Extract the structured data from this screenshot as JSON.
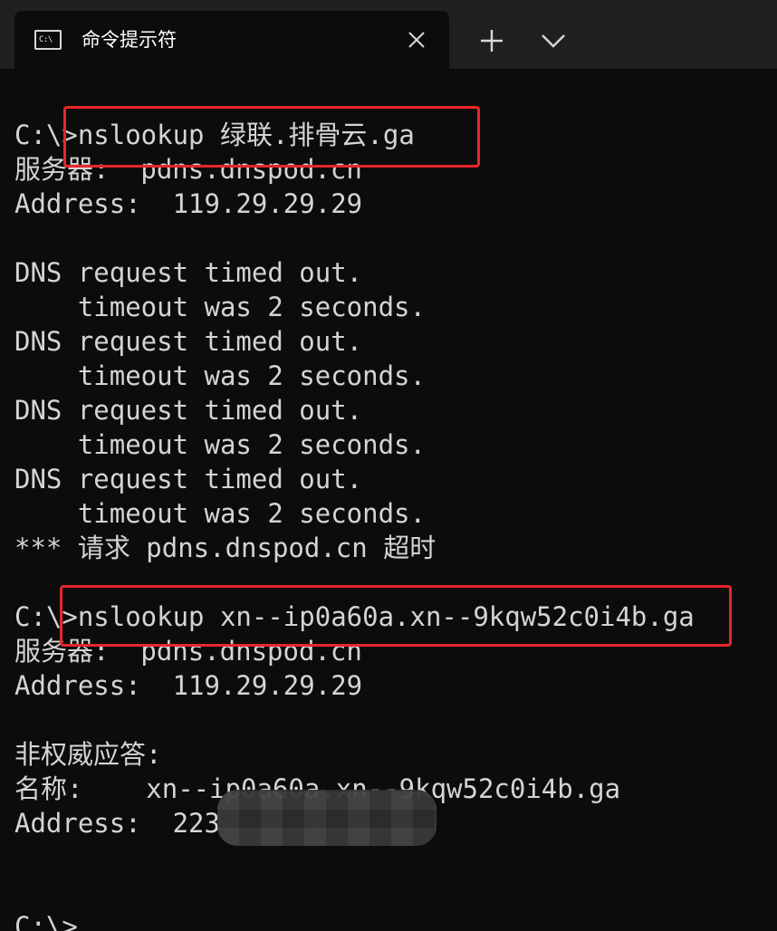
{
  "window": {
    "tab": {
      "title": "命令提示符",
      "icon_label": "C:\\",
      "icon": "cmd-icon",
      "close_icon": "close-icon"
    },
    "new_tab_icon": "plus-icon",
    "dropdown_icon": "chevron-down-icon"
  },
  "colors": {
    "background": "#0c0c0c",
    "tabbar": "#202020",
    "text": "#d4d4d4",
    "highlight": "#e8262c"
  },
  "terminal": {
    "lines": [
      "C:\\>nslookup 绿联.排骨云.ga",
      "服务器:  pdns.dnspod.cn",
      "Address:  119.29.29.29",
      "",
      "DNS request timed out.",
      "    timeout was 2 seconds.",
      "DNS request timed out.",
      "    timeout was 2 seconds.",
      "DNS request timed out.",
      "    timeout was 2 seconds.",
      "DNS request timed out.",
      "    timeout was 2 seconds.",
      "*** 请求 pdns.dnspod.cn 超时",
      "",
      "C:\\>nslookup xn--ip0a60a.xn--9kqw52c0i4b.ga",
      "服务器:  pdns.dnspod.cn",
      "Address:  119.29.29.29",
      "",
      "非权威应答:",
      "名称:    xn--ip0a60a.xn--9kqw52c0i4b.ga",
      "Address:  223",
      "",
      "",
      "C:\\>"
    ]
  }
}
